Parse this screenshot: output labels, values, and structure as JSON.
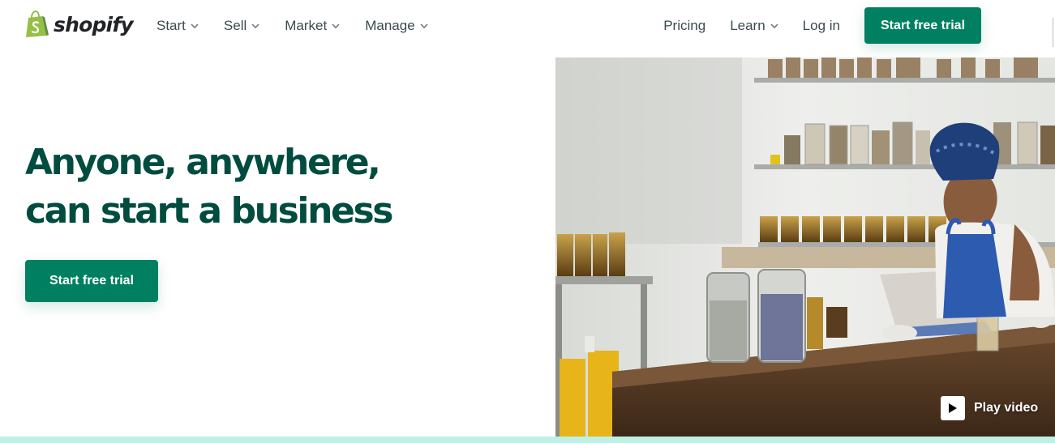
{
  "brand": {
    "name": "shopify",
    "logo_color": "#95bf47"
  },
  "nav": {
    "left": [
      {
        "label": "Start"
      },
      {
        "label": "Sell"
      },
      {
        "label": "Market"
      },
      {
        "label": "Manage"
      }
    ],
    "pricing": "Pricing",
    "learn": "Learn",
    "login": "Log in",
    "cta": "Start free trial"
  },
  "hero": {
    "title_line1": "Anyone, anywhere,",
    "title_line2": "can start a business",
    "cta": "Start free trial",
    "play_video": "Play video",
    "image_subject": "woman working on tablet in shop with jars on shelves"
  },
  "colors": {
    "primary": "#008060",
    "heading": "#004c3f",
    "band": "#bff0e5"
  }
}
